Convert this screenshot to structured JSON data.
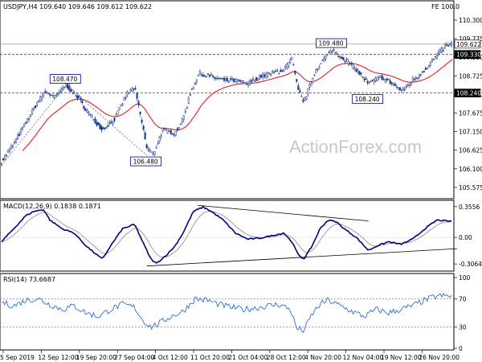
{
  "chart_data": [
    {
      "type": "candlestick",
      "title": "USDJPY,H4  109.640 109.646 109.612 109.622",
      "corner_label": "FE 100.0",
      "watermark": "ActionForex.com",
      "ylim": [
        105.3,
        110.55
      ],
      "y_ticks": [
        "110.300",
        "109.775",
        "109.250",
        "108.725",
        "108.200",
        "107.675",
        "107.150",
        "106.625",
        "106.100",
        "105.575"
      ],
      "current_price": 109.622,
      "current_price_label": "109.622",
      "levels": [
        {
          "value": 109.33,
          "label": "109.330"
        },
        {
          "value": 108.24,
          "label": "108.240"
        }
      ],
      "annotations": [
        {
          "label": "108.470",
          "x_index": 80,
          "value": 108.47
        },
        {
          "label": "106.480",
          "x_index": 180,
          "value": 106.48
        },
        {
          "label": "109.480",
          "x_index": 410,
          "value": 109.48
        },
        {
          "label": "108.240",
          "x_index": 455,
          "value": 108.24
        }
      ],
      "x_labels": [
        "5 Sep 2019",
        "12 Sep 12:00",
        "19 Sep 20:00",
        "27 Sep 04:00",
        "4 Oct 12:00",
        "11 Oct 20:00",
        "21 Oct 04:00",
        "28 Oct 12:00",
        "4 Nov 20:00",
        "12 Nov 04:00",
        "19 Nov 12:00",
        "26 Nov 20:00"
      ],
      "series_anchors": [
        [
          0,
          106.3
        ],
        [
          15,
          106.8
        ],
        [
          30,
          107.4
        ],
        [
          45,
          108.0
        ],
        [
          55,
          108.3
        ],
        [
          65,
          108.1
        ],
        [
          80,
          108.47
        ],
        [
          95,
          108.1
        ],
        [
          110,
          107.6
        ],
        [
          125,
          107.2
        ],
        [
          140,
          107.5
        ],
        [
          155,
          108.2
        ],
        [
          165,
          108.4
        ],
        [
          175,
          107.3
        ],
        [
          180,
          106.7
        ],
        [
          188,
          106.5
        ],
        [
          200,
          107.2
        ],
        [
          215,
          107.1
        ],
        [
          225,
          107.5
        ],
        [
          235,
          108.3
        ],
        [
          245,
          108.8
        ],
        [
          260,
          108.7
        ],
        [
          275,
          108.6
        ],
        [
          290,
          108.6
        ],
        [
          305,
          108.5
        ],
        [
          320,
          108.7
        ],
        [
          335,
          108.8
        ],
        [
          350,
          108.9
        ],
        [
          360,
          109.2
        ],
        [
          368,
          108.3
        ],
        [
          375,
          108.0
        ],
        [
          390,
          108.9
        ],
        [
          400,
          109.2
        ],
        [
          410,
          109.45
        ],
        [
          425,
          109.2
        ],
        [
          440,
          108.9
        ],
        [
          455,
          108.5
        ],
        [
          470,
          108.7
        ],
        [
          485,
          108.5
        ],
        [
          497,
          108.3
        ],
        [
          510,
          108.6
        ],
        [
          525,
          108.9
        ],
        [
          540,
          109.3
        ],
        [
          550,
          109.55
        ],
        [
          557,
          109.622
        ]
      ]
    },
    {
      "type": "line",
      "title": "MACD(12,26,9) 0.1838 0.1871",
      "ylim": [
        -0.37,
        0.4
      ],
      "y_ticks": [
        "0.3556",
        "0.00",
        "-0.3064"
      ],
      "macd_anchors": [
        [
          0,
          -0.05
        ],
        [
          10,
          0.05
        ],
        [
          20,
          0.15
        ],
        [
          30,
          0.25
        ],
        [
          40,
          0.3
        ],
        [
          52,
          0.32
        ],
        [
          60,
          0.2
        ],
        [
          75,
          0.1
        ],
        [
          90,
          0.05
        ],
        [
          105,
          -0.1
        ],
        [
          118,
          -0.2
        ],
        [
          125,
          -0.25
        ],
        [
          135,
          -0.1
        ],
        [
          150,
          0.1
        ],
        [
          165,
          0.15
        ],
        [
          175,
          -0.05
        ],
        [
          185,
          -0.25
        ],
        [
          192,
          -0.3
        ],
        [
          205,
          -0.2
        ],
        [
          215,
          -0.1
        ],
        [
          225,
          0.05
        ],
        [
          238,
          0.3
        ],
        [
          250,
          0.35
        ],
        [
          260,
          0.3
        ],
        [
          275,
          0.2
        ],
        [
          290,
          0.05
        ],
        [
          305,
          -0.02
        ],
        [
          320,
          -0.01
        ],
        [
          335,
          0.02
        ],
        [
          350,
          0.05
        ],
        [
          360,
          -0.05
        ],
        [
          368,
          -0.2
        ],
        [
          375,
          -0.25
        ],
        [
          385,
          -0.1
        ],
        [
          395,
          0.1
        ],
        [
          405,
          0.2
        ],
        [
          415,
          0.18
        ],
        [
          425,
          0.1
        ],
        [
          440,
          0.0
        ],
        [
          455,
          -0.15
        ],
        [
          465,
          -0.1
        ],
        [
          480,
          -0.05
        ],
        [
          495,
          -0.08
        ],
        [
          510,
          -0.02
        ],
        [
          525,
          0.1
        ],
        [
          540,
          0.2
        ],
        [
          557,
          0.1838
        ]
      ],
      "trendlines": [
        {
          "from": [
            243,
            0.37
          ],
          "to": [
            455,
            0.19
          ]
        },
        {
          "from": [
            180,
            -0.33
          ],
          "to": [
            565,
            -0.13
          ]
        }
      ]
    },
    {
      "type": "line",
      "title": "RSI(14) 73.6687",
      "ylim": [
        0,
        100
      ],
      "y_ticks": [
        "100",
        "70",
        "30",
        "0"
      ],
      "levels": [
        70,
        30
      ],
      "rsi_anchors": [
        [
          0,
          65
        ],
        [
          15,
          60
        ],
        [
          30,
          68
        ],
        [
          45,
          70
        ],
        [
          60,
          62
        ],
        [
          75,
          55
        ],
        [
          90,
          60
        ],
        [
          105,
          50
        ],
        [
          120,
          45
        ],
        [
          135,
          55
        ],
        [
          150,
          62
        ],
        [
          165,
          58
        ],
        [
          175,
          40
        ],
        [
          185,
          30
        ],
        [
          195,
          35
        ],
        [
          210,
          45
        ],
        [
          225,
          52
        ],
        [
          240,
          70
        ],
        [
          255,
          68
        ],
        [
          270,
          62
        ],
        [
          285,
          58
        ],
        [
          300,
          55
        ],
        [
          315,
          57
        ],
        [
          330,
          60
        ],
        [
          345,
          62
        ],
        [
          358,
          55
        ],
        [
          366,
          28
        ],
        [
          375,
          25
        ],
        [
          385,
          48
        ],
        [
          395,
          62
        ],
        [
          405,
          68
        ],
        [
          420,
          60
        ],
        [
          435,
          52
        ],
        [
          450,
          45
        ],
        [
          465,
          55
        ],
        [
          480,
          50
        ],
        [
          495,
          55
        ],
        [
          510,
          60
        ],
        [
          525,
          68
        ],
        [
          540,
          74
        ],
        [
          557,
          73.6687
        ]
      ]
    }
  ],
  "colors": {
    "candle": "#1a3a8c",
    "ma": "#e02020",
    "macd": "#000080",
    "signal": "#a0a0a0",
    "rsi": "#2e6fd6",
    "trend": "#000000",
    "grid": "#444444",
    "label_box": "#000080"
  }
}
